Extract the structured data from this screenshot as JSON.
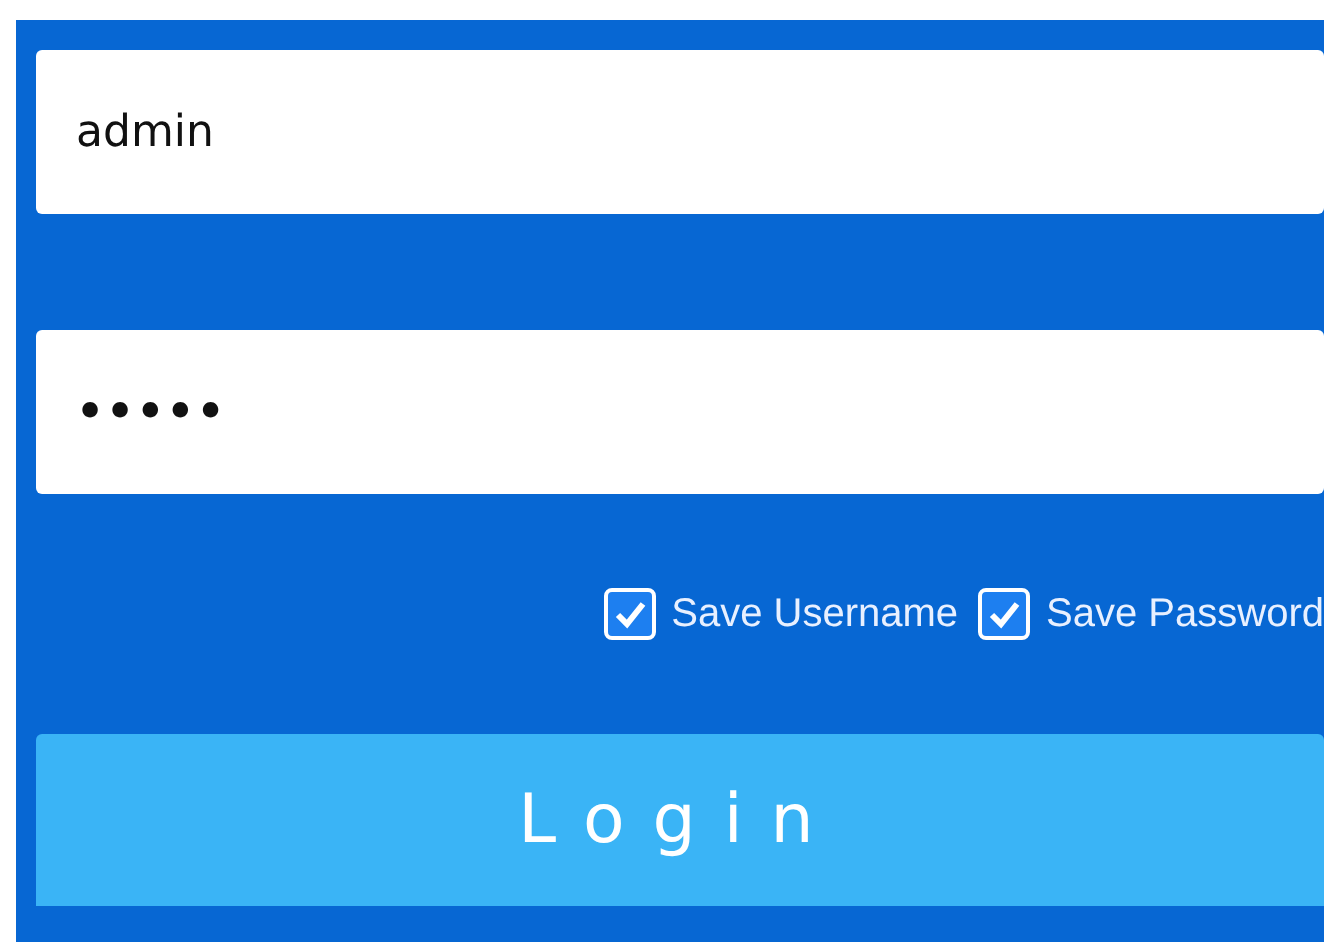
{
  "username": {
    "value": "admin"
  },
  "password": {
    "value": "•••••"
  },
  "options": [
    {
      "label": "Save Username",
      "checked": true
    },
    {
      "label": "Save Password",
      "checked": true
    }
  ],
  "login_button": {
    "label": "Login"
  }
}
